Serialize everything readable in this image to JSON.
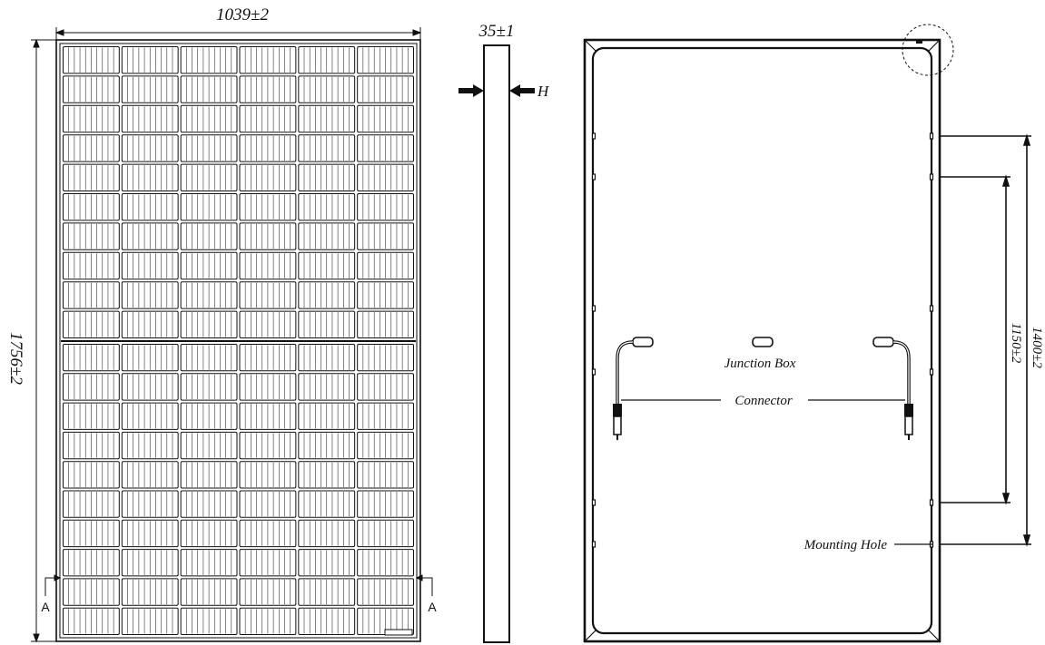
{
  "front_view": {
    "width_label": "1039±2",
    "height_label": "1756±2",
    "section_mark_left": "A",
    "section_mark_right": "A",
    "cell_columns": 6,
    "cell_rows_per_half": 10,
    "fingers_per_cell": 9
  },
  "side_view": {
    "thickness_label": "35±1",
    "height_mark_label": "H"
  },
  "back_view": {
    "junction_box_label": "Junction Box",
    "connector_label": "Connector",
    "mounting_hole_label": "Mounting Hole",
    "dim_outer_label": "1400±2",
    "dim_inner_label": "1150±2"
  },
  "colors": {
    "line": "#111111",
    "background": "#ffffff",
    "frame_fill": "#f2f2f2"
  }
}
